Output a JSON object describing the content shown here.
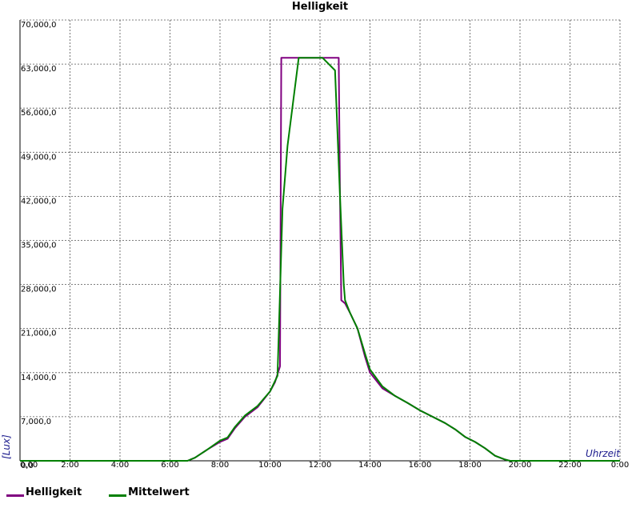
{
  "chart_data": {
    "type": "line",
    "title": "Helligkeit",
    "xlabel": "Uhrzeit",
    "ylabel": "[Lux]",
    "xlim": [
      0,
      24
    ],
    "ylim": [
      0,
      70000
    ],
    "x_ticks": [
      "0,00",
      "2:00",
      "4:00",
      "6:00",
      "8:00",
      "10:00",
      "12:00",
      "14:00",
      "16:00",
      "18:00",
      "20:00",
      "22:00",
      "0:00"
    ],
    "y_ticks": [
      "0,0",
      "7,000,0",
      "14,000,0",
      "21,000,0",
      "28,000,0",
      "35,000,0",
      "42,000,0",
      "49,000,0",
      "56,000,0",
      "63,000,0",
      "70,000,0"
    ],
    "grid": true,
    "legend_position": "bottom-left",
    "series": [
      {
        "name": "Helligkeit",
        "color": "#800080",
        "points": [
          [
            0,
            0
          ],
          [
            6.7,
            0
          ],
          [
            7.0,
            500
          ],
          [
            7.5,
            1800
          ],
          [
            8.0,
            3000
          ],
          [
            8.3,
            3500
          ],
          [
            8.6,
            5200
          ],
          [
            9.0,
            7000
          ],
          [
            9.5,
            8500
          ],
          [
            10.0,
            11000
          ],
          [
            10.2,
            12500
          ],
          [
            10.4,
            15000
          ],
          [
            10.45,
            64000
          ],
          [
            12.75,
            64000
          ],
          [
            12.8,
            42000
          ],
          [
            12.85,
            25500
          ],
          [
            13.0,
            25000
          ],
          [
            13.2,
            23500
          ],
          [
            13.5,
            21000
          ],
          [
            13.8,
            16500
          ],
          [
            14.0,
            14000
          ],
          [
            14.5,
            11500
          ],
          [
            15.0,
            10300
          ],
          [
            15.5,
            9200
          ],
          [
            16.0,
            8000
          ],
          [
            16.5,
            7000
          ],
          [
            17.0,
            6000
          ],
          [
            17.4,
            5000
          ],
          [
            17.8,
            3800
          ],
          [
            18.2,
            3000
          ],
          [
            18.6,
            2000
          ],
          [
            19.0,
            800
          ],
          [
            19.4,
            200
          ],
          [
            19.6,
            0
          ],
          [
            24,
            0
          ]
        ]
      },
      {
        "name": "Mittelwert",
        "color": "#008000",
        "points": [
          [
            0,
            0
          ],
          [
            6.7,
            0
          ],
          [
            7.0,
            500
          ],
          [
            7.5,
            1800
          ],
          [
            8.0,
            3200
          ],
          [
            8.3,
            3700
          ],
          [
            8.6,
            5400
          ],
          [
            9.0,
            7200
          ],
          [
            9.5,
            8700
          ],
          [
            10.0,
            11000
          ],
          [
            10.3,
            13500
          ],
          [
            10.5,
            40000
          ],
          [
            10.7,
            50000
          ],
          [
            11.15,
            64000
          ],
          [
            12.1,
            64000
          ],
          [
            12.6,
            62000
          ],
          [
            12.8,
            42000
          ],
          [
            12.95,
            28000
          ],
          [
            13.0,
            25500
          ],
          [
            13.2,
            23500
          ],
          [
            13.5,
            21000
          ],
          [
            13.8,
            17000
          ],
          [
            14.0,
            14500
          ],
          [
            14.5,
            11800
          ],
          [
            15.0,
            10300
          ],
          [
            15.5,
            9200
          ],
          [
            16.0,
            8000
          ],
          [
            16.5,
            7000
          ],
          [
            17.0,
            6000
          ],
          [
            17.4,
            5000
          ],
          [
            17.8,
            3800
          ],
          [
            18.2,
            3000
          ],
          [
            18.6,
            2000
          ],
          [
            19.0,
            800
          ],
          [
            19.4,
            200
          ],
          [
            19.6,
            0
          ],
          [
            24,
            0
          ]
        ]
      }
    ]
  }
}
